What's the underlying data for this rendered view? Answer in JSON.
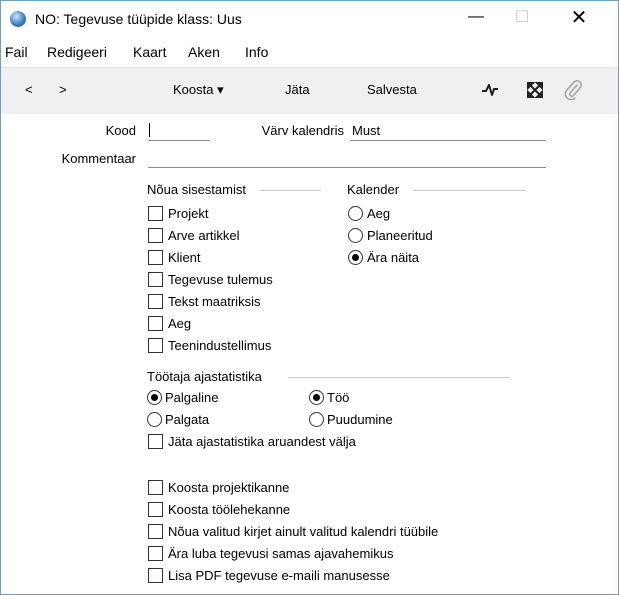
{
  "window": {
    "title": "NO: Tegevuse tüüpide klass: Uus",
    "min_glyph": "—",
    "max_glyph": "☐",
    "close_glyph": "✕"
  },
  "menu": [
    "Fail",
    "Redigeeri",
    "Kaart",
    "Aken",
    "Info"
  ],
  "toolbar": {
    "prev_glyph": "<",
    "next_glyph": ">",
    "create_label": "Koosta ▾",
    "discard_label": "Jäta",
    "save_label": "Salvesta"
  },
  "form": {
    "code_label": "Kood",
    "code_value": "",
    "calendar_color_label": "Värv kalendris",
    "calendar_color_value": "Must",
    "comment_label": "Kommentaar",
    "comment_value": ""
  },
  "required": {
    "heading": "Nõua sisestamist",
    "items": [
      {
        "label": "Projekt",
        "checked": false
      },
      {
        "label": "Arve artikkel",
        "checked": false
      },
      {
        "label": "Klient",
        "checked": false
      },
      {
        "label": "Tegevuse tulemus",
        "checked": false
      },
      {
        "label": "Tekst maatriksis",
        "checked": false
      },
      {
        "label": "Aeg",
        "checked": false
      },
      {
        "label": "Teenindustellimus",
        "checked": false
      }
    ]
  },
  "calendar": {
    "heading": "Kalender",
    "options": [
      {
        "label": "Aeg",
        "selected": false
      },
      {
        "label": "Planeeritud",
        "selected": false
      },
      {
        "label": "Ära näita",
        "selected": true
      }
    ]
  },
  "timestats": {
    "heading": "Töötaja ajastatistika",
    "paid": {
      "label": "Palgaline",
      "selected": true
    },
    "unpaid": {
      "label": "Palgata",
      "selected": false
    },
    "work": {
      "label": "Töö",
      "selected": true
    },
    "absence": {
      "label": "Puudumine",
      "selected": false
    },
    "exclude": {
      "label": "Jäta ajastatistika aruandest välja",
      "checked": false
    }
  },
  "options": [
    {
      "label": "Koosta projektikanne",
      "checked": false
    },
    {
      "label": "Koosta töölehekanne",
      "checked": false
    },
    {
      "label": "Nõua valitud kirjet ainult valitud kalendri tüübile",
      "checked": false
    },
    {
      "label": "Ära luba tegevusi samas ajavahemikus",
      "checked": false
    },
    {
      "label": "Lisa PDF tegevuse e-maili manusesse",
      "checked": false
    }
  ],
  "icons": {
    "app": "app-globe-icon",
    "activity": "activity-icon",
    "expand": "expand-icon",
    "attach": "paperclip-icon"
  }
}
